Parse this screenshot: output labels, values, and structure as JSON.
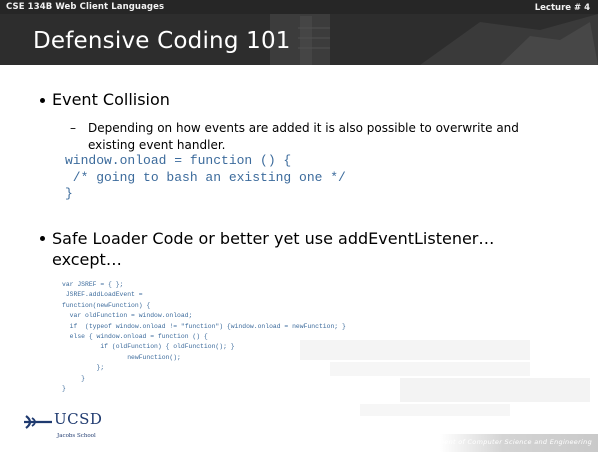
{
  "header": {
    "course": "CSE 134B  Web Client Languages",
    "lecture": "Lecture # 4",
    "title": "Defensive Coding 101"
  },
  "body": {
    "bullet1": "Event Collision",
    "bullet1_sub": "Depending on how events are added it is also possible to overwrite and existing event handler.",
    "code1": "window.onload = function () {\n /* going to bash an existing one */\n}",
    "bullet2": "Safe Loader Code or better yet use addEventListener…except…",
    "code2": "var JSREF = { };\n JSREF.addLoadEvent =\nfunction(newFunction) {\n  var oldFunction = window.onload;\n  if  (typeof window.onload != \"function\") {window.onload = newFunction; }\n  else { window.onload = function () {\n          if (oldFunction) { oldFunction(); }\n                 newFunction();\n         };\n     }\n}"
  },
  "logo": {
    "name": "UCSD",
    "sub": "Jacobs School"
  },
  "footer": "Department of Computer Science and Engineering",
  "colors": {
    "header_bg": "#2f2f2f",
    "code": "#3c6b9c",
    "logo": "#1f3a6f"
  }
}
